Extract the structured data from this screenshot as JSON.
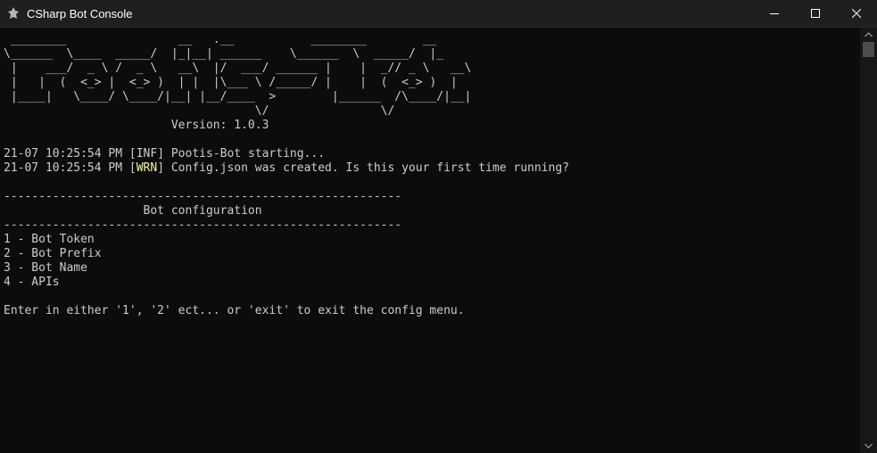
{
  "window": {
    "title": "CSharp Bot Console",
    "icons": {
      "app": "bot-console-icon",
      "minimize": "minimize-icon",
      "maximize": "maximize-icon",
      "close": "close-icon"
    }
  },
  "console": {
    "banner": [
      " ________                __   .__           ________        __",
      "\\______  \\____  _____/  |_|__| ______    \\______  \\  _____/  |_",
      " |    ___/  _ \\ /  _ \\   __\\  |/  ___/ ______ |    |  _// _ \\   __\\",
      " |   |  (  <_> |  <_> )  | |  |\\___ \\ /_____/ |    |  (  <_> )  |",
      " |____|   \\____/ \\____/|__| |__/____  >        |______  /\\____/|__|",
      "                                    \\/                \\/"
    ],
    "version": "                        Version: 1.0.3",
    "logs": [
      {
        "time": "21-07 10:25:54 PM",
        "level": "INF",
        "message": "Pootis-Bot starting..."
      },
      {
        "time": "21-07 10:25:54 PM",
        "level": "WRN",
        "message": "Config.json was created. Is this your first time running?"
      }
    ],
    "separator": "---------------------------------------------------------",
    "menu_title": "                    Bot configuration",
    "menu_items": [
      "1 - Bot Token",
      "2 - Bot Prefix",
      "3 - Bot Name",
      "4 - APIs"
    ],
    "prompt": "Enter in either '1', '2' ect... or 'exit' to exit the config menu.",
    "colors": {
      "background": "#0c0c0c",
      "text": "#cccccc",
      "warn": "#f9f1a5"
    }
  }
}
